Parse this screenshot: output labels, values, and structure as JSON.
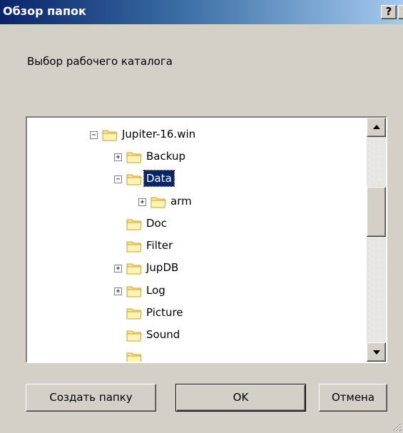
{
  "window": {
    "title": "Обзор папок",
    "help_label": "?",
    "close_label": "×"
  },
  "prompt": "Выбор рабочего каталога",
  "tree": {
    "items": [
      {
        "label": "Jupiter-16.win",
        "expander": "−",
        "selected": false
      },
      {
        "label": "Backup",
        "expander": "+",
        "selected": false
      },
      {
        "label": "Data",
        "expander": "−",
        "selected": true
      },
      {
        "label": "arm",
        "expander": "+",
        "selected": false
      },
      {
        "label": "Doc",
        "expander": "",
        "selected": false
      },
      {
        "label": "Filter",
        "expander": "",
        "selected": false
      },
      {
        "label": "JupDB",
        "expander": "+",
        "selected": false
      },
      {
        "label": "Log",
        "expander": "+",
        "selected": false
      },
      {
        "label": "Picture",
        "expander": "",
        "selected": false
      },
      {
        "label": "Sound",
        "expander": "",
        "selected": false
      },
      {
        "label": "",
        "expander": "",
        "selected": false
      }
    ]
  },
  "buttons": {
    "new_folder": "Создать папку",
    "ok": "OK",
    "cancel": "Отмена"
  },
  "colors": {
    "selection": "#0a246a",
    "folder_fill": "#fde58a",
    "folder_stroke": "#c9a227"
  }
}
